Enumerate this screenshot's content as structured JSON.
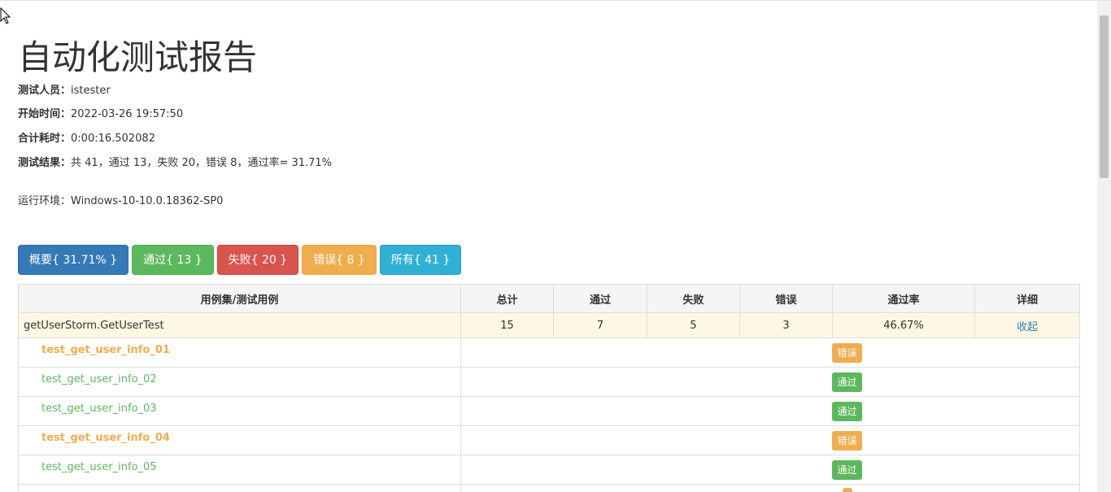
{
  "report": {
    "title": "自动化测试报告",
    "tester_label": "测试人员：",
    "tester_value": "istester",
    "start_label": "开始时间：",
    "start_value": "2022-03-26 19:57:50",
    "duration_label": "合计耗时：",
    "duration_value": "0:00:16.502082",
    "result_label": "测试结果：",
    "result_value": "共 41，通过 13，失败 20，错误 8，通过率= 31.71%",
    "env_text": "运行环境：Windows-10-10.0.18362-SP0"
  },
  "filters": {
    "summary": "概要{ 31.71% }",
    "pass": "通过{ 13 }",
    "fail": "失败{ 20 }",
    "error": "错误{ 8 }",
    "all": "所有{ 41 }"
  },
  "table": {
    "headers": [
      "用例集/测试用例",
      "总计",
      "通过",
      "失败",
      "错误",
      "通过率",
      "详细"
    ],
    "suite": {
      "name": "getUserStorm.GetUserTest",
      "total": "15",
      "pass": "7",
      "fail": "5",
      "error": "3",
      "rate": "46.67%",
      "toggle": "收起"
    },
    "cases": [
      {
        "name": "test_get_user_info_01",
        "status": "错误"
      },
      {
        "name": "test_get_user_info_02",
        "status": "通过"
      },
      {
        "name": "test_get_user_info_03",
        "status": "通过"
      },
      {
        "name": "test_get_user_info_04",
        "status": "错误"
      },
      {
        "name": "test_get_user_info_05",
        "status": "通过"
      }
    ]
  },
  "colors": {
    "summary": "#337ab7",
    "pass": "#5cb85c",
    "fail": "#d9534f",
    "error": "#f0ad4e",
    "all": "#31b0d5",
    "suite_row_bg": "#fcf8e3"
  },
  "icons": {
    "cursor": "mouse-pointer-icon"
  }
}
